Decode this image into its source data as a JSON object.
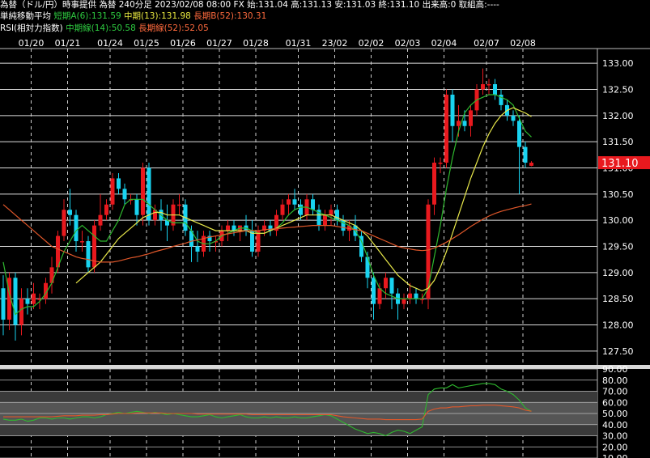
{
  "header": {
    "instrument": "為替（ドル/円）時事提供 為替 240分足 2023/02/08 08:00 FX 始:131.04 高:131.13 安:131.03 終:131.10 出来高:0 取組高:----",
    "ma_label": "単純移動平均",
    "ma_short": "短期A(6):131.59",
    "ma_mid": "中期(13):131.98",
    "ma_long": "長期B(52):130.31",
    "rsi_label": "RSI(相対力指数)",
    "rsi_mid": "中期線(14):50.58",
    "rsi_long": "長期線(52):52.05"
  },
  "colors": {
    "up": "#e8191e",
    "down": "#19d3f0",
    "ma_short": "#2eb82e",
    "ma_mid": "#e8e84a",
    "ma_long": "#e0572a",
    "price_tag": "#e8191e"
  },
  "chart_data": [
    {
      "type": "candlestick",
      "title": "",
      "x_labels": [
        "01/20",
        "01/21",
        "01/24",
        "01/25",
        "01/26",
        "01/27",
        "01/28",
        "01/31",
        "23/02",
        "02/02",
        "02/03",
        "02/04",
        "02/07",
        "02/08"
      ],
      "ylim": [
        127.25,
        133.25
      ],
      "y_ticks": [
        "127.50",
        "128.00",
        "128.50",
        "129.00",
        "129.50",
        "130.00",
        "130.50",
        "131.00",
        "131.50",
        "132.00",
        "132.50",
        "133.00"
      ],
      "last_price": "131.10",
      "candles": [
        {
          "o": 128.7,
          "h": 128.95,
          "l": 127.8,
          "c": 128.1
        },
        {
          "o": 128.1,
          "h": 129.0,
          "l": 127.9,
          "c": 128.9
        },
        {
          "o": 128.9,
          "h": 129.0,
          "l": 127.7,
          "c": 128.0
        },
        {
          "o": 128.0,
          "h": 128.7,
          "l": 127.8,
          "c": 128.5
        },
        {
          "o": 128.5,
          "h": 128.7,
          "l": 128.2,
          "c": 128.4
        },
        {
          "o": 128.4,
          "h": 128.8,
          "l": 128.3,
          "c": 128.6
        },
        {
          "o": 128.5,
          "h": 128.6,
          "l": 128.3,
          "c": 128.5
        },
        {
          "o": 128.5,
          "h": 128.9,
          "l": 128.4,
          "c": 128.8
        },
        {
          "o": 128.8,
          "h": 129.3,
          "l": 128.6,
          "c": 129.1
        },
        {
          "o": 129.1,
          "h": 129.8,
          "l": 129.0,
          "c": 129.7
        },
        {
          "o": 129.7,
          "h": 130.4,
          "l": 129.6,
          "c": 130.2
        },
        {
          "o": 130.2,
          "h": 130.6,
          "l": 129.9,
          "c": 130.1
        },
        {
          "o": 130.1,
          "h": 130.2,
          "l": 129.4,
          "c": 129.6
        },
        {
          "o": 129.6,
          "h": 129.8,
          "l": 129.4,
          "c": 129.6
        },
        {
          "o": 129.6,
          "h": 129.7,
          "l": 129.0,
          "c": 129.1
        },
        {
          "o": 129.1,
          "h": 130.0,
          "l": 129.0,
          "c": 129.9
        },
        {
          "o": 129.9,
          "h": 130.5,
          "l": 129.8,
          "c": 130.1
        },
        {
          "o": 130.1,
          "h": 130.4,
          "l": 130.0,
          "c": 130.3
        },
        {
          "o": 130.3,
          "h": 130.9,
          "l": 130.2,
          "c": 130.8
        },
        {
          "o": 130.8,
          "h": 130.9,
          "l": 130.5,
          "c": 130.6
        },
        {
          "o": 130.6,
          "h": 130.7,
          "l": 130.3,
          "c": 130.4
        },
        {
          "o": 130.4,
          "h": 130.5,
          "l": 130.3,
          "c": 130.4
        },
        {
          "o": 130.4,
          "h": 130.5,
          "l": 129.9,
          "c": 130.1
        },
        {
          "o": 130.1,
          "h": 131.1,
          "l": 129.9,
          "c": 131.0
        },
        {
          "o": 131.0,
          "h": 131.1,
          "l": 129.9,
          "c": 130.0
        },
        {
          "o": 130.0,
          "h": 130.3,
          "l": 129.9,
          "c": 130.2
        },
        {
          "o": 130.2,
          "h": 130.4,
          "l": 129.8,
          "c": 130.0
        },
        {
          "o": 130.0,
          "h": 130.3,
          "l": 129.6,
          "c": 129.9
        },
        {
          "o": 129.9,
          "h": 130.4,
          "l": 129.8,
          "c": 130.3
        },
        {
          "o": 130.3,
          "h": 130.5,
          "l": 130.1,
          "c": 130.3
        },
        {
          "o": 130.3,
          "h": 130.4,
          "l": 129.7,
          "c": 129.8
        },
        {
          "o": 129.8,
          "h": 129.9,
          "l": 129.2,
          "c": 129.5
        },
        {
          "o": 129.5,
          "h": 129.8,
          "l": 129.2,
          "c": 129.4
        },
        {
          "o": 129.4,
          "h": 129.8,
          "l": 129.3,
          "c": 129.7
        },
        {
          "o": 129.7,
          "h": 129.8,
          "l": 129.4,
          "c": 129.6
        },
        {
          "o": 129.6,
          "h": 129.7,
          "l": 129.4,
          "c": 129.6
        },
        {
          "o": 129.6,
          "h": 129.9,
          "l": 129.5,
          "c": 129.8
        },
        {
          "o": 129.8,
          "h": 130.0,
          "l": 129.6,
          "c": 129.9
        },
        {
          "o": 129.9,
          "h": 130.0,
          "l": 129.7,
          "c": 129.8
        },
        {
          "o": 129.8,
          "h": 129.9,
          "l": 129.6,
          "c": 129.9
        },
        {
          "o": 129.9,
          "h": 130.1,
          "l": 129.7,
          "c": 129.8
        },
        {
          "o": 129.8,
          "h": 130.0,
          "l": 129.3,
          "c": 129.4
        },
        {
          "o": 129.4,
          "h": 129.9,
          "l": 129.3,
          "c": 129.8
        },
        {
          "o": 129.8,
          "h": 130.0,
          "l": 129.7,
          "c": 129.9
        },
        {
          "o": 129.9,
          "h": 130.0,
          "l": 129.7,
          "c": 129.8
        },
        {
          "o": 129.8,
          "h": 130.2,
          "l": 129.7,
          "c": 130.1
        },
        {
          "o": 130.1,
          "h": 130.4,
          "l": 130.0,
          "c": 130.3
        },
        {
          "o": 130.3,
          "h": 130.5,
          "l": 130.1,
          "c": 130.4
        },
        {
          "o": 130.4,
          "h": 130.6,
          "l": 130.2,
          "c": 130.3
        },
        {
          "o": 130.3,
          "h": 130.4,
          "l": 130.0,
          "c": 130.1
        },
        {
          "o": 130.1,
          "h": 130.5,
          "l": 130.0,
          "c": 130.4
        },
        {
          "o": 130.4,
          "h": 130.5,
          "l": 130.1,
          "c": 130.2
        },
        {
          "o": 130.2,
          "h": 130.3,
          "l": 129.8,
          "c": 129.9
        },
        {
          "o": 129.9,
          "h": 130.2,
          "l": 129.8,
          "c": 130.1
        },
        {
          "o": 130.1,
          "h": 130.3,
          "l": 129.9,
          "c": 130.2
        },
        {
          "o": 130.2,
          "h": 130.3,
          "l": 129.9,
          "c": 130.0
        },
        {
          "o": 130.0,
          "h": 130.1,
          "l": 129.7,
          "c": 129.8
        },
        {
          "o": 129.8,
          "h": 130.0,
          "l": 129.6,
          "c": 129.9
        },
        {
          "o": 129.9,
          "h": 130.1,
          "l": 129.6,
          "c": 129.7
        },
        {
          "o": 129.7,
          "h": 129.8,
          "l": 129.2,
          "c": 129.3
        },
        {
          "o": 129.3,
          "h": 129.4,
          "l": 128.7,
          "c": 128.9
        },
        {
          "o": 128.9,
          "h": 129.0,
          "l": 128.1,
          "c": 128.4
        },
        {
          "o": 128.4,
          "h": 128.8,
          "l": 128.3,
          "c": 128.7
        },
        {
          "o": 128.7,
          "h": 129.0,
          "l": 128.5,
          "c": 128.9
        },
        {
          "o": 128.9,
          "h": 128.9,
          "l": 128.3,
          "c": 128.6
        },
        {
          "o": 128.6,
          "h": 128.7,
          "l": 128.1,
          "c": 128.4
        },
        {
          "o": 128.4,
          "h": 128.6,
          "l": 128.3,
          "c": 128.5
        },
        {
          "o": 128.5,
          "h": 128.8,
          "l": 128.4,
          "c": 128.6
        },
        {
          "o": 128.6,
          "h": 128.7,
          "l": 128.4,
          "c": 128.5
        },
        {
          "o": 128.5,
          "h": 128.6,
          "l": 128.4,
          "c": 128.5
        },
        {
          "o": 128.5,
          "h": 130.4,
          "l": 128.3,
          "c": 130.3
        },
        {
          "o": 130.3,
          "h": 131.2,
          "l": 130.1,
          "c": 131.1
        },
        {
          "o": 131.1,
          "h": 131.2,
          "l": 130.9,
          "c": 131.1
        },
        {
          "o": 131.1,
          "h": 132.5,
          "l": 131.0,
          "c": 132.4
        },
        {
          "o": 132.4,
          "h": 132.5,
          "l": 131.5,
          "c": 131.8
        },
        {
          "o": 131.8,
          "h": 132.2,
          "l": 131.6,
          "c": 131.9
        },
        {
          "o": 131.9,
          "h": 132.1,
          "l": 131.7,
          "c": 131.8
        },
        {
          "o": 131.8,
          "h": 132.2,
          "l": 131.6,
          "c": 132.1
        },
        {
          "o": 132.1,
          "h": 132.6,
          "l": 132.0,
          "c": 132.5
        },
        {
          "o": 132.5,
          "h": 132.9,
          "l": 132.4,
          "c": 132.6
        },
        {
          "o": 132.6,
          "h": 132.7,
          "l": 132.4,
          "c": 132.6
        },
        {
          "o": 132.6,
          "h": 132.7,
          "l": 132.3,
          "c": 132.4
        },
        {
          "o": 132.4,
          "h": 132.5,
          "l": 132.1,
          "c": 132.2
        },
        {
          "o": 132.2,
          "h": 132.3,
          "l": 131.9,
          "c": 132.0
        },
        {
          "o": 132.0,
          "h": 132.1,
          "l": 131.8,
          "c": 131.9
        },
        {
          "o": 131.9,
          "h": 132.0,
          "l": 130.5,
          "c": 131.4
        },
        {
          "o": 131.4,
          "h": 131.5,
          "l": 131.0,
          "c": 131.1
        },
        {
          "o": 131.04,
          "h": 131.13,
          "l": 131.03,
          "c": 131.1
        }
      ],
      "series": [
        {
          "key": "ma_short",
          "values": [
            129.2,
            128.6,
            128.2,
            128.3,
            128.35,
            128.35,
            128.45,
            128.6,
            128.8,
            129.1,
            129.4,
            129.6,
            129.8,
            129.9,
            129.8,
            129.7,
            129.6,
            129.6,
            129.8,
            130.0,
            130.3,
            130.4,
            130.4,
            130.4,
            130.3,
            130.2,
            130.1,
            130.0,
            129.95,
            129.95,
            129.95,
            129.8,
            129.6,
            129.55,
            129.55,
            129.6,
            129.7,
            129.75,
            129.8,
            129.85,
            129.85,
            129.8,
            129.75,
            129.75,
            129.8,
            129.85,
            129.95,
            130.1,
            130.2,
            130.25,
            130.25,
            130.2,
            130.15,
            130.1,
            130.05,
            130.0,
            129.95,
            129.9,
            129.8,
            129.6,
            129.3,
            128.95,
            128.7,
            128.6,
            128.55,
            128.5,
            128.5,
            128.5,
            128.5,
            128.5,
            128.7,
            129.3,
            129.9,
            130.6,
            131.2,
            131.7,
            132.05,
            132.2,
            132.3,
            132.35,
            132.4,
            132.4,
            132.35,
            132.3,
            132.2,
            131.95,
            131.7,
            131.59
          ]
        },
        {
          "key": "ma_mid",
          "values": [
            null,
            null,
            null,
            null,
            null,
            null,
            null,
            null,
            null,
            null,
            null,
            null,
            128.8,
            128.9,
            129.0,
            129.1,
            129.2,
            129.35,
            129.5,
            129.65,
            129.75,
            129.85,
            129.95,
            130.05,
            130.1,
            130.15,
            130.15,
            130.1,
            130.1,
            130.1,
            130.05,
            130.0,
            129.95,
            129.9,
            129.85,
            129.8,
            129.8,
            129.8,
            129.8,
            129.8,
            129.8,
            129.75,
            129.75,
            129.75,
            129.8,
            129.85,
            129.9,
            129.95,
            130.0,
            130.05,
            130.1,
            130.1,
            130.1,
            130.1,
            130.1,
            130.05,
            130.0,
            129.95,
            129.9,
            129.8,
            129.7,
            129.55,
            129.4,
            129.25,
            129.1,
            128.95,
            128.85,
            128.75,
            128.7,
            128.65,
            128.7,
            128.85,
            129.1,
            129.4,
            129.75,
            130.1,
            130.45,
            130.8,
            131.1,
            131.4,
            131.65,
            131.85,
            132.0,
            132.1,
            132.15,
            132.1,
            132.05,
            131.98
          ]
        },
        {
          "key": "ma_long",
          "values": [
            130.3,
            130.2,
            130.1,
            130.0,
            129.9,
            129.8,
            129.7,
            129.6,
            129.5,
            129.45,
            129.4,
            129.35,
            129.3,
            129.27,
            129.25,
            129.22,
            129.2,
            129.2,
            129.2,
            129.22,
            129.25,
            129.28,
            129.3,
            129.33,
            129.36,
            129.4,
            129.43,
            129.46,
            129.5,
            129.53,
            129.56,
            129.6,
            129.62,
            129.65,
            129.68,
            129.7,
            129.72,
            129.74,
            129.76,
            129.78,
            129.8,
            129.8,
            129.8,
            129.82,
            129.83,
            129.84,
            129.85,
            129.86,
            129.87,
            129.88,
            129.89,
            129.9,
            129.9,
            129.9,
            129.9,
            129.88,
            129.86,
            129.84,
            129.82,
            129.8,
            129.75,
            129.7,
            129.65,
            129.6,
            129.55,
            129.5,
            129.47,
            129.45,
            129.43,
            129.42,
            129.43,
            129.47,
            129.52,
            129.58,
            129.65,
            129.72,
            129.8,
            129.88,
            129.95,
            130.02,
            130.08,
            130.13,
            130.17,
            130.2,
            130.23,
            130.26,
            130.28,
            130.31
          ]
        }
      ]
    },
    {
      "type": "line",
      "title": "",
      "ylim": [
        10,
        90
      ],
      "y_ticks": [
        "10.00",
        "20.00",
        "30.00",
        "40.00",
        "50.00",
        "60.00",
        "70.00",
        "80.00",
        "90.00"
      ],
      "series": [
        {
          "key": "rsi_mid",
          "values": [
            45,
            44,
            44,
            45,
            43,
            44,
            46,
            46,
            45,
            46,
            46,
            45,
            46,
            47,
            47,
            46,
            47,
            49,
            50,
            51,
            50,
            51,
            52,
            51,
            50,
            51,
            50,
            49,
            50,
            49,
            48,
            47,
            47,
            48,
            49,
            47,
            46,
            47,
            48,
            49,
            47,
            46,
            46,
            47,
            46,
            47,
            46,
            46,
            47,
            46,
            46,
            47,
            48,
            49,
            48,
            45,
            42,
            39,
            36,
            34,
            32,
            33,
            32,
            30,
            33,
            35,
            34,
            32,
            35,
            38,
            67,
            72,
            73,
            73,
            76,
            73,
            74,
            75,
            76,
            77,
            77,
            76,
            72,
            70,
            67,
            62,
            55,
            52
          ]
        },
        {
          "key": "rsi_long",
          "values": [
            47,
            47,
            47,
            47,
            47,
            47,
            47,
            47,
            47,
            47.5,
            48,
            48,
            48,
            48.5,
            48.5,
            48.5,
            49,
            49,
            49.5,
            50,
            50,
            50,
            50.5,
            50.5,
            50.5,
            50.5,
            50.5,
            50,
            50,
            50,
            50,
            50,
            49.5,
            49.5,
            49.5,
            49.5,
            49.5,
            49.5,
            49.5,
            49.5,
            49.5,
            49,
            49,
            49,
            49,
            49,
            49,
            49,
            49,
            49,
            49,
            49,
            49,
            49,
            49,
            48,
            47,
            46.5,
            46,
            45.5,
            45,
            45,
            45,
            44.5,
            44.5,
            44.5,
            44.5,
            44.5,
            44.5,
            45,
            52,
            54,
            55,
            55,
            56,
            56,
            56.5,
            57,
            57,
            57.5,
            57.5,
            57.5,
            57,
            56.5,
            56,
            55,
            53,
            52.05
          ]
        }
      ]
    }
  ]
}
